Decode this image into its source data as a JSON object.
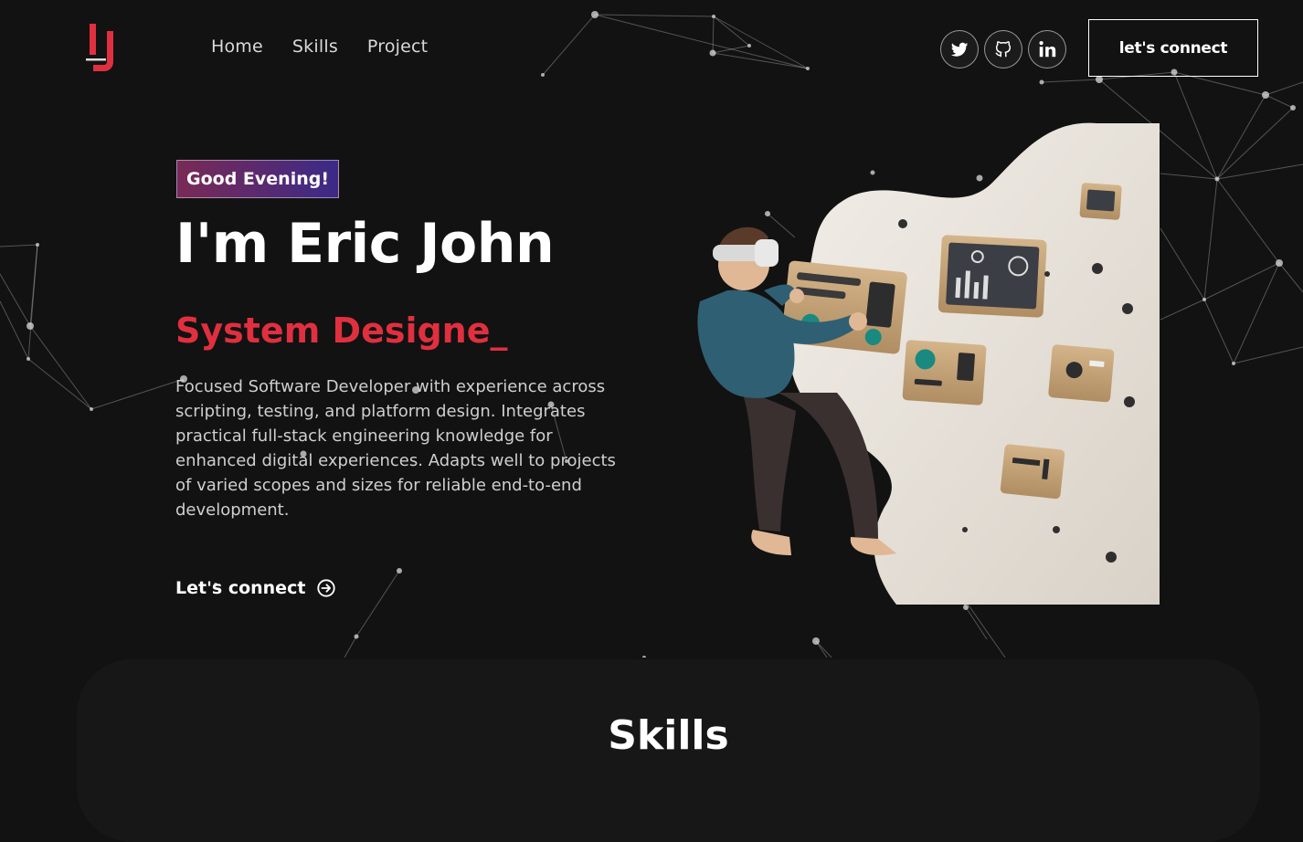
{
  "nav": {
    "logo": "logo-mark",
    "links": [
      "Home",
      "Skills",
      "Project"
    ],
    "socials": [
      {
        "name": "twitter-icon"
      },
      {
        "name": "github-icon"
      },
      {
        "name": "linkedin-icon"
      }
    ],
    "connect_label": "let's connect"
  },
  "hero": {
    "greeting": "Good Evening!",
    "headline": "I'm Eric John",
    "role": "System Designe_",
    "bio": "Focused Software Developer with experience across scripting, testing, and platform design. Integrates practical full-stack engineering knowledge for enhanced digital experiences. Adapts well to projects of varied scopes and sizes for reliable end-to-end development.",
    "cta_label": "Let's connect",
    "cta_icon": "arrow-right-circle-icon",
    "illustration": "vr-developer-illustration"
  },
  "skills": {
    "title": "Skills"
  },
  "colors": {
    "background": "#121212",
    "accent": "#e0303f",
    "panel": "#171717"
  }
}
